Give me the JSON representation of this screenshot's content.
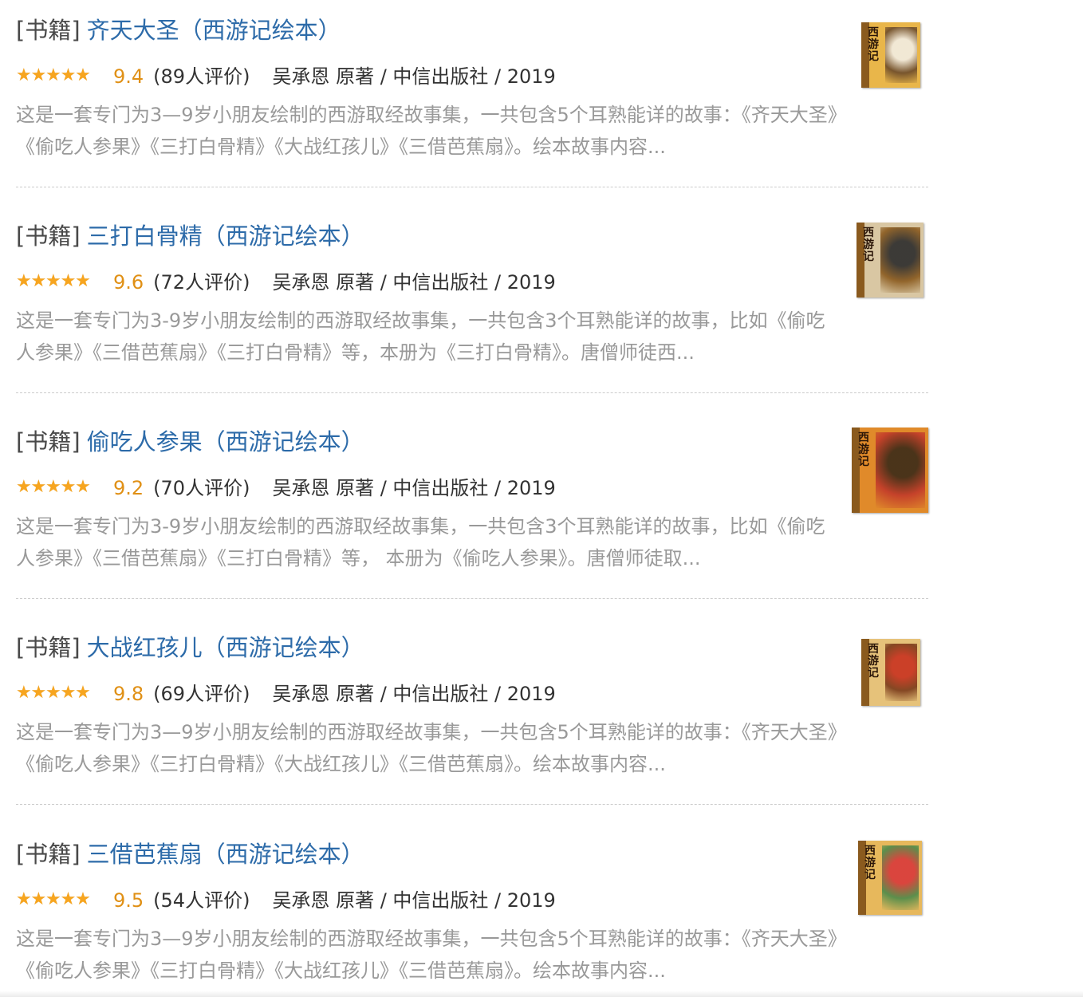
{
  "results": [
    {
      "category": "[书籍]",
      "title": "齐天大圣（西游记绘本）",
      "stars": 4.5,
      "rating": "9.4",
      "count": "(89人评价)",
      "author": "吴承恩 原著 / 中信出版社 / 2019",
      "description": "这是一套专门为3—9岁小朋友绘制的西游取经故事集，一共包含5个耳熟能详的故事：《齐天大圣》《偷吃人参果》《三打白骨精》《大战红孩儿》《三借芭蕉扇》。绘本故事内容...",
      "cover_label": "西游记",
      "cover_colors": [
        "#e9b64a",
        "#f2ede4",
        "#6b4a2a"
      ]
    },
    {
      "category": "[书籍]",
      "title": "三打白骨精（西游记绘本）",
      "stars": 5,
      "rating": "9.6",
      "count": "(72人评价)",
      "author": "吴承恩 原著 / 中信出版社 / 2019",
      "description": "这是一套专门为3-9岁小朋友绘制的西游取经故事集，一共包含3个耳熟能详的故事，比如《偷吃人参果》《三借芭蕉扇》《三打白骨精》等，本册为《三打白骨精》。唐僧师徒西...",
      "cover_label": "西游记",
      "cover_colors": [
        "#d9c7a3",
        "#2b2b2b",
        "#8a5a1e"
      ]
    },
    {
      "category": "[书籍]",
      "title": "偷吃人参果（西游记绘本）",
      "stars": 4.5,
      "rating": "9.2",
      "count": "(70人评价)",
      "author": "吴承恩 原著 / 中信出版社 / 2019",
      "description": "这是一套专门为3-9岁小朋友绘制的西游取经故事集，一共包含3个耳熟能详的故事，比如《偷吃人参果》《三借芭蕉扇》《三打白骨精》等， 本册为《偷吃人参果》。唐僧师徒取...",
      "cover_label": "西游记",
      "cover_colors": [
        "#e08a2a",
        "#3a2a18",
        "#c23a2a"
      ]
    },
    {
      "category": "[书籍]",
      "title": "大战红孩儿（西游记绘本）",
      "stars": 5,
      "rating": "9.8",
      "count": "(69人评价)",
      "author": "吴承恩 原著 / 中信出版社 / 2019",
      "description": "这是一套专门为3—9岁小朋友绘制的西游取经故事集，一共包含5个耳熟能详的故事：《齐天大圣》《偷吃人参果》《三打白骨精》《大战红孩儿》《三借芭蕉扇》。绘本故事内容...",
      "cover_label": "西游记",
      "cover_colors": [
        "#e6c27a",
        "#c8311f",
        "#7a3a1a"
      ]
    },
    {
      "category": "[书籍]",
      "title": "三借芭蕉扇（西游记绘本）",
      "stars": 5,
      "rating": "9.5",
      "count": "(54人评价)",
      "author": "吴承恩 原著 / 中信出版社 / 2019",
      "description": "这是一套专门为3—9岁小朋友绘制的西游取经故事集，一共包含5个耳熟能详的故事：《齐天大圣》《偷吃人参果》《三打白骨精》《大战红孩儿》《三借芭蕉扇》。绘本故事内容...",
      "cover_label": "西游记",
      "cover_colors": [
        "#e7b85c",
        "#d9383a",
        "#4c8a4a"
      ]
    }
  ],
  "colors": {
    "title_link": "#2d6ba9",
    "rating": "#e09015",
    "star": "#f7a51f",
    "description": "#999999"
  }
}
